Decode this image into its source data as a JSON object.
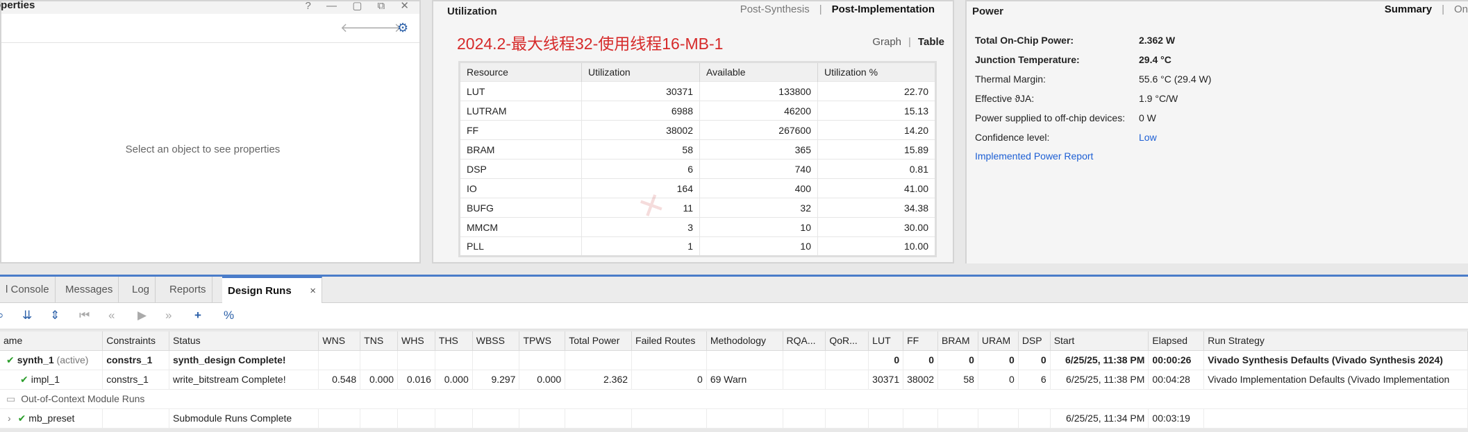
{
  "properties": {
    "title": "operties",
    "window_controls": "? — ▢ ⧉ ✕",
    "back_icon": "arrow-left-icon",
    "forward_icon": "arrow-right-icon",
    "settings_icon": "gear-icon",
    "empty_text": "Select an object to see properties"
  },
  "utilization": {
    "title": "Utilization",
    "tab_post_synthesis": "Post-Synthesis",
    "tab_post_implementation": "Post-Implementation",
    "subtitle": "2024.2-最大线程32-使用线程16-MB-1",
    "view_graph": "Graph",
    "view_table": "Table",
    "headers": [
      "Resource",
      "Utilization",
      "Available",
      "Utilization %"
    ],
    "rows": [
      [
        "LUT",
        "30371",
        "133800",
        "22.70"
      ],
      [
        "LUTRAM",
        "6988",
        "46200",
        "15.13"
      ],
      [
        "FF",
        "38002",
        "267600",
        "14.20"
      ],
      [
        "BRAM",
        "58",
        "365",
        "15.89"
      ],
      [
        "DSP",
        "6",
        "740",
        "0.81"
      ],
      [
        "IO",
        "164",
        "400",
        "41.00"
      ],
      [
        "BUFG",
        "11",
        "32",
        "34.38"
      ],
      [
        "MMCM",
        "3",
        "10",
        "30.00"
      ],
      [
        "PLL",
        "1",
        "10",
        "10.00"
      ]
    ]
  },
  "power": {
    "title": "Power",
    "tab_summary": "Summary",
    "tab_on": "On",
    "rows": [
      {
        "k": "Total On-Chip Power:",
        "v": "2.362 W"
      },
      {
        "k": "Junction Temperature:",
        "v": "29.4 °C"
      },
      {
        "k": "Thermal Margin:",
        "v": "55.6 °C (29.4 W)"
      },
      {
        "k": "Effective ϑJA:",
        "v": "1.9 °C/W"
      },
      {
        "k": "Power supplied to off-chip devices:",
        "v": "0 W"
      },
      {
        "k": "Confidence level:",
        "v": "Low"
      }
    ],
    "report_link": "Implemented Power Report"
  },
  "tabs": [
    "l Console",
    "Messages",
    "Log",
    "Reports",
    "Design Runs"
  ],
  "tab_close": "×",
  "runs": {
    "headers": [
      "ame",
      "Constraints",
      "Status",
      "WNS",
      "TNS",
      "WHS",
      "THS",
      "WBSS",
      "TPWS",
      "Total Power",
      "Failed Routes",
      "Methodology",
      "RQA...",
      "QoR...",
      "LUT",
      "FF",
      "BRAM",
      "URAM",
      "DSP",
      "Start",
      "Elapsed",
      "Run Strategy"
    ],
    "synth": {
      "name": "synth_1",
      "active": "(active)",
      "constraints": "constrs_1",
      "status": "synth_design Complete!",
      "lut": "0",
      "ff": "0",
      "bram": "0",
      "uram": "0",
      "dsp": "0",
      "start": "6/25/25, 11:38 PM",
      "elapsed": "00:00:26",
      "strategy": "Vivado Synthesis Defaults (Vivado Synthesis 2024)"
    },
    "impl": {
      "name": "impl_1",
      "constraints": "constrs_1",
      "status": "write_bitstream Complete!",
      "wns": "0.548",
      "tns": "0.000",
      "whs": "0.016",
      "ths": "0.000",
      "wbss": "9.297",
      "tpws": "0.000",
      "power": "2.362",
      "failed": "0",
      "meth": "69 Warn",
      "lut": "30371",
      "ff": "38002",
      "bram": "58",
      "uram": "0",
      "dsp": "6",
      "start": "6/25/25, 11:38 PM",
      "elapsed": "00:04:28",
      "strategy": "Vivado Implementation Defaults (Vivado Implementation"
    },
    "ooc_label": "Out-of-Context Module Runs",
    "mb": {
      "name": "mb_preset",
      "status": "Submodule Runs Complete",
      "start": "6/25/25, 11:34 PM",
      "elapsed": "00:03:19"
    }
  }
}
